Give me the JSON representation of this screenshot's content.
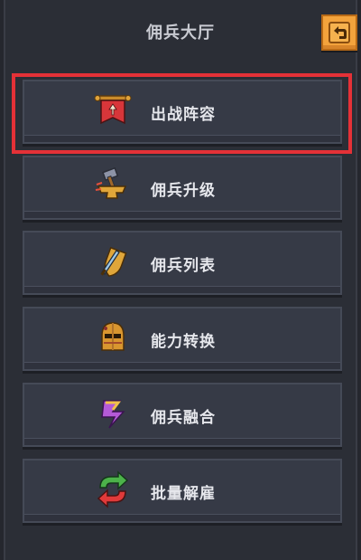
{
  "header": {
    "title": "佣兵大厅",
    "back_icon": "back-arrow-icon"
  },
  "menu": {
    "items": [
      {
        "label": "出战阵容",
        "icon": "banner-icon",
        "highlighted": true
      },
      {
        "label": "佣兵升级",
        "icon": "anvil-hammer-icon",
        "highlighted": false
      },
      {
        "label": "佣兵列表",
        "icon": "shield-sword-icon",
        "highlighted": false
      },
      {
        "label": "能力转换",
        "icon": "knight-helmet-icon",
        "highlighted": false
      },
      {
        "label": "佣兵融合",
        "icon": "swirl-fusion-icon",
        "highlighted": false
      },
      {
        "label": "批量解雇",
        "icon": "swap-arrows-icon",
        "highlighted": false
      }
    ]
  },
  "colors": {
    "background": "#2b2e36",
    "button": "#363a46",
    "back_button": "#f3a33c",
    "highlight": "#e43137"
  }
}
